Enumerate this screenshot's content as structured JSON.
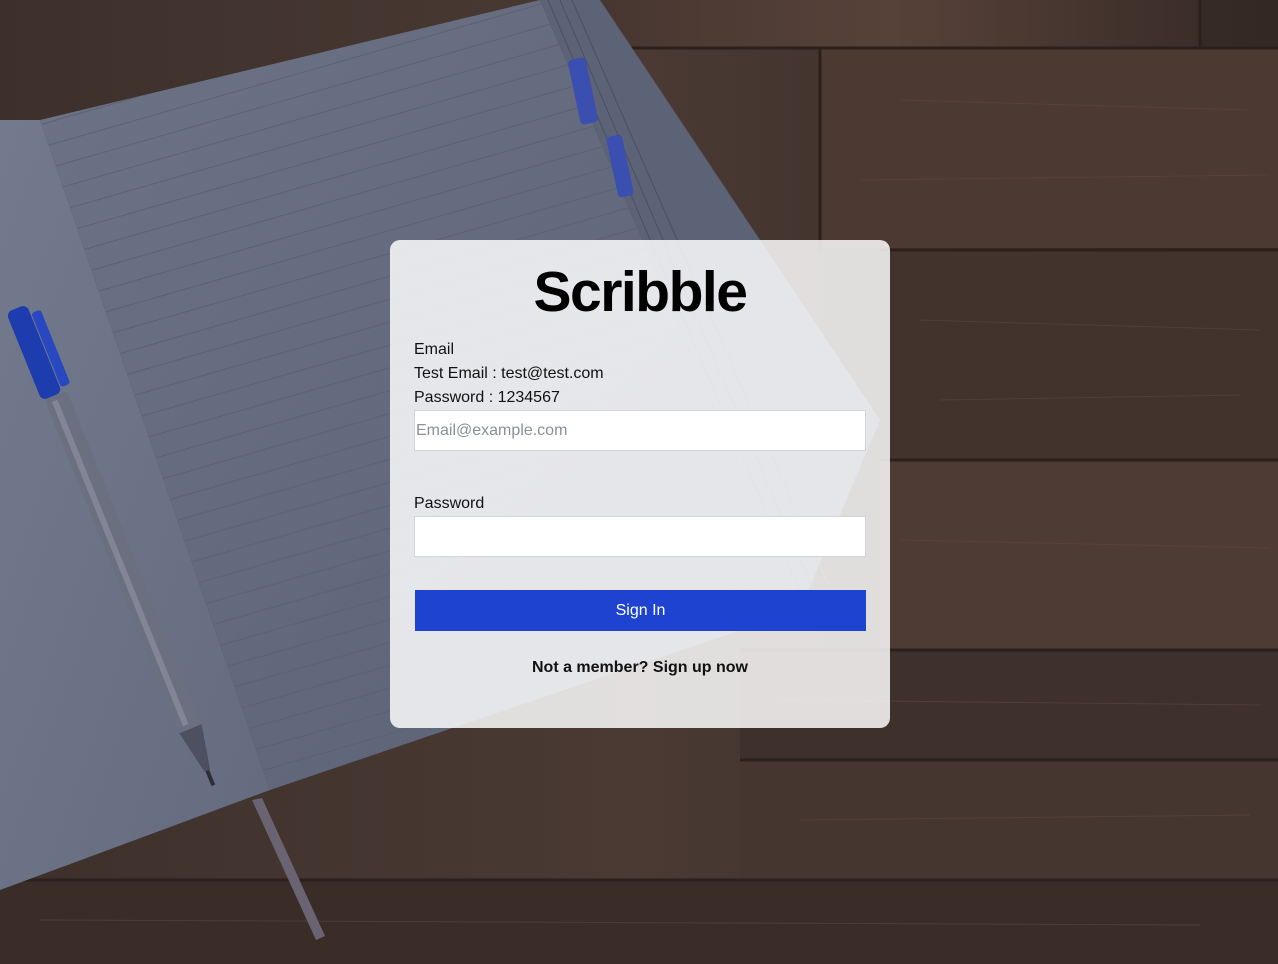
{
  "app": {
    "title": "Scribble"
  },
  "login": {
    "email_label": "Email",
    "test_email_hint": "Test Email : test@test.com",
    "test_password_hint": "Password : 1234567",
    "email_placeholder": "Email@example.com",
    "email_value": "",
    "password_label": "Password",
    "password_value": "",
    "submit_label": "Sign In",
    "signup_text": "Not a member? Sign up now"
  },
  "theme": {
    "button_color": "#1d43d0",
    "card_background": "rgba(255,255,255,0.84)"
  },
  "background": {
    "description_icon": "notebook-and-pen-on-wooden-table"
  }
}
